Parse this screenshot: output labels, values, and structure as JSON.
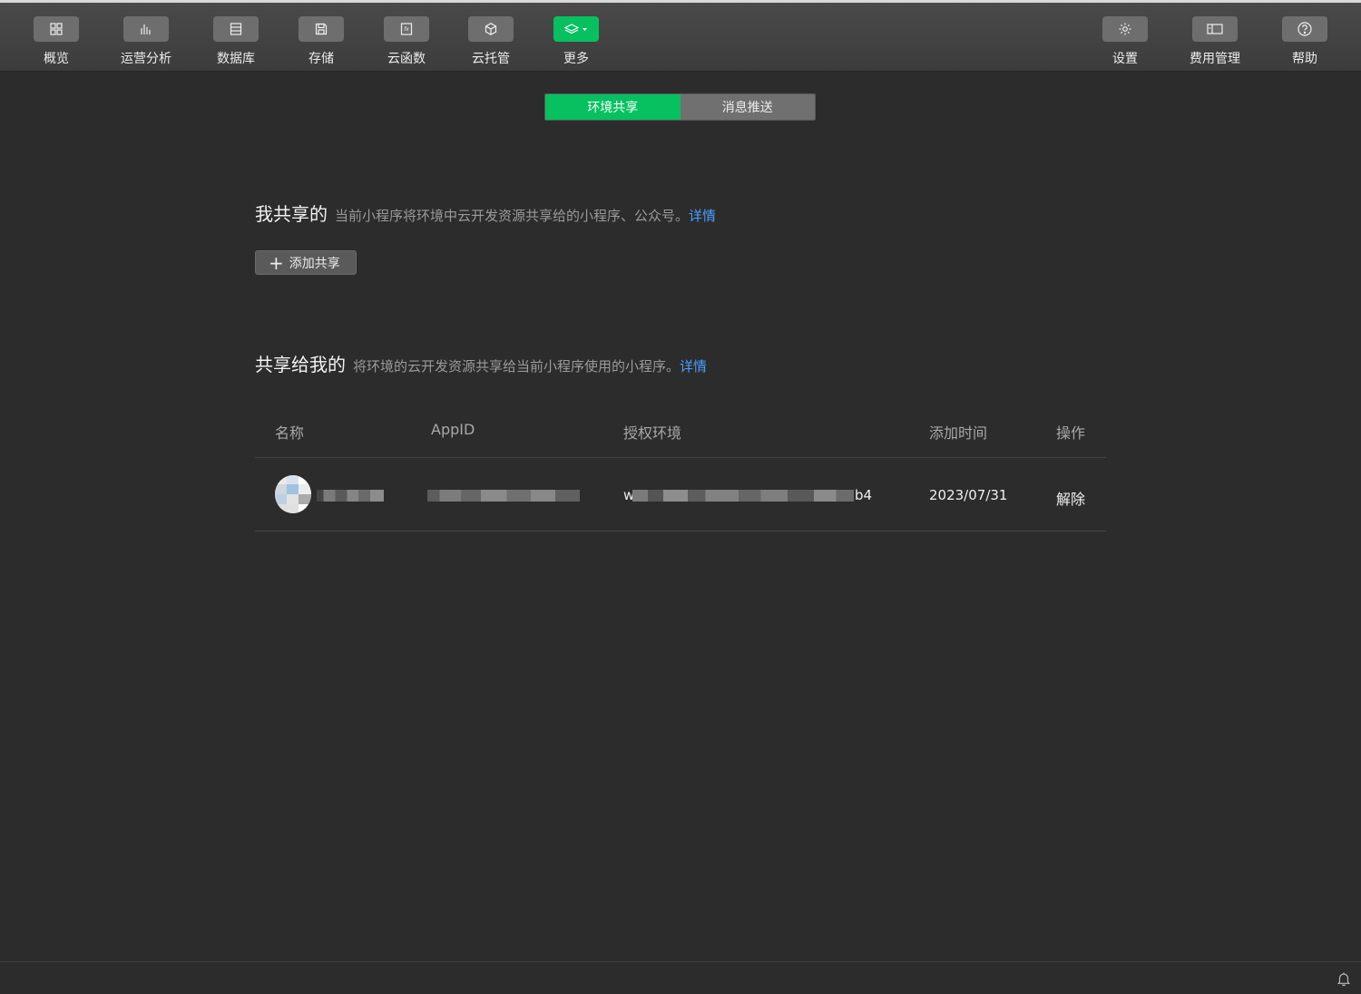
{
  "toolbar": {
    "left": [
      {
        "label": "概览",
        "icon": "grid-icon"
      },
      {
        "label": "运营分析",
        "icon": "bar-chart-icon"
      },
      {
        "label": "数据库",
        "icon": "database-icon"
      },
      {
        "label": "存储",
        "icon": "save-icon"
      },
      {
        "label": "云函数",
        "icon": "function-icon"
      },
      {
        "label": "云托管",
        "icon": "cube-icon"
      },
      {
        "label": "更多",
        "icon": "layers-icon",
        "active": true
      }
    ],
    "right": [
      {
        "label": "设置",
        "icon": "gear-icon"
      },
      {
        "label": "费用管理",
        "icon": "billing-icon"
      },
      {
        "label": "帮助",
        "icon": "help-icon"
      }
    ]
  },
  "tabs": [
    "环境共享",
    "消息推送"
  ],
  "active_tab": "环境共享",
  "my_shared": {
    "title": "我共享的",
    "description": "当前小程序将环境中云开发资源共享给的小程序、公众号。",
    "link": "详情",
    "add_button": "添加共享"
  },
  "shared_to_me": {
    "title": "共享给我的",
    "description": "将环境的云开发资源共享给当前小程序使用的小程序。",
    "link": "详情",
    "columns": [
      "名称",
      "AppID",
      "授权环境",
      "添加时间",
      "操作"
    ],
    "rows": [
      {
        "env_prefix": "w",
        "env_suffix": "b4",
        "date": "2023/07/31",
        "action": "解除"
      }
    ]
  },
  "colors": {
    "accent": "#07c160",
    "link": "#4a9eff",
    "background": "#2c2c2c"
  }
}
